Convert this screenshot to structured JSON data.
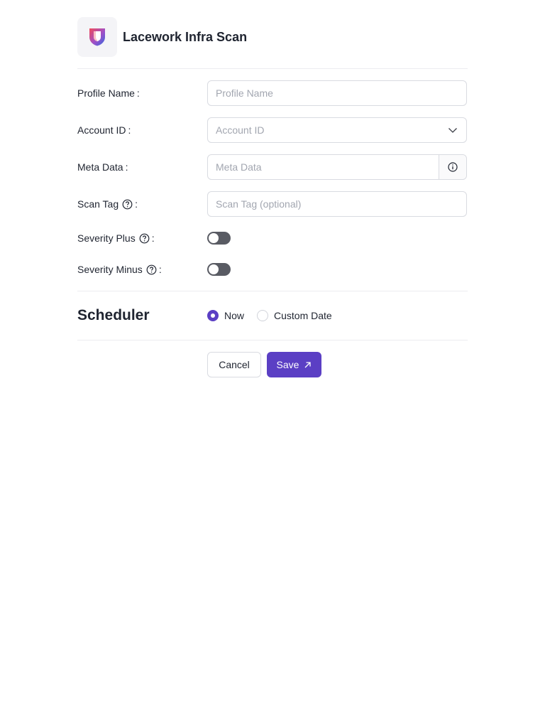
{
  "header": {
    "title": "Lacework Infra Scan",
    "logo_icon": "shield-logo-icon",
    "colors": {
      "logo_left": "#f04c5a",
      "logo_right": "#2f6ae0"
    }
  },
  "form": {
    "profile_name": {
      "label": "Profile Name",
      "placeholder": "Profile Name",
      "value": ""
    },
    "account_id": {
      "label": "Account ID",
      "placeholder": "Account ID",
      "value": ""
    },
    "meta_data": {
      "label": "Meta Data",
      "placeholder": "Meta Data",
      "value": "",
      "addon_icon": "info-icon"
    },
    "scan_tag": {
      "label": "Scan Tag",
      "placeholder": "Scan Tag (optional)",
      "value": "",
      "help_icon": "question-circle-icon"
    },
    "severity_plus": {
      "label": "Severity Plus",
      "enabled": false,
      "help_icon": "question-circle-icon"
    },
    "severity_minus": {
      "label": "Severity Minus",
      "enabled": false,
      "help_icon": "question-circle-icon"
    },
    "colon": ":"
  },
  "scheduler": {
    "title": "Scheduler",
    "options": [
      {
        "label": "Now",
        "selected": true
      },
      {
        "label": "Custom Date",
        "selected": false
      }
    ]
  },
  "actions": {
    "cancel_label": "Cancel",
    "save_label": "Save",
    "save_icon": "arrow-up-right-icon"
  },
  "colors": {
    "accent": "#5b3fc4",
    "toggle_off": "#595b63",
    "border": "#d9dbe1",
    "placeholder": "#a2a6b0"
  }
}
